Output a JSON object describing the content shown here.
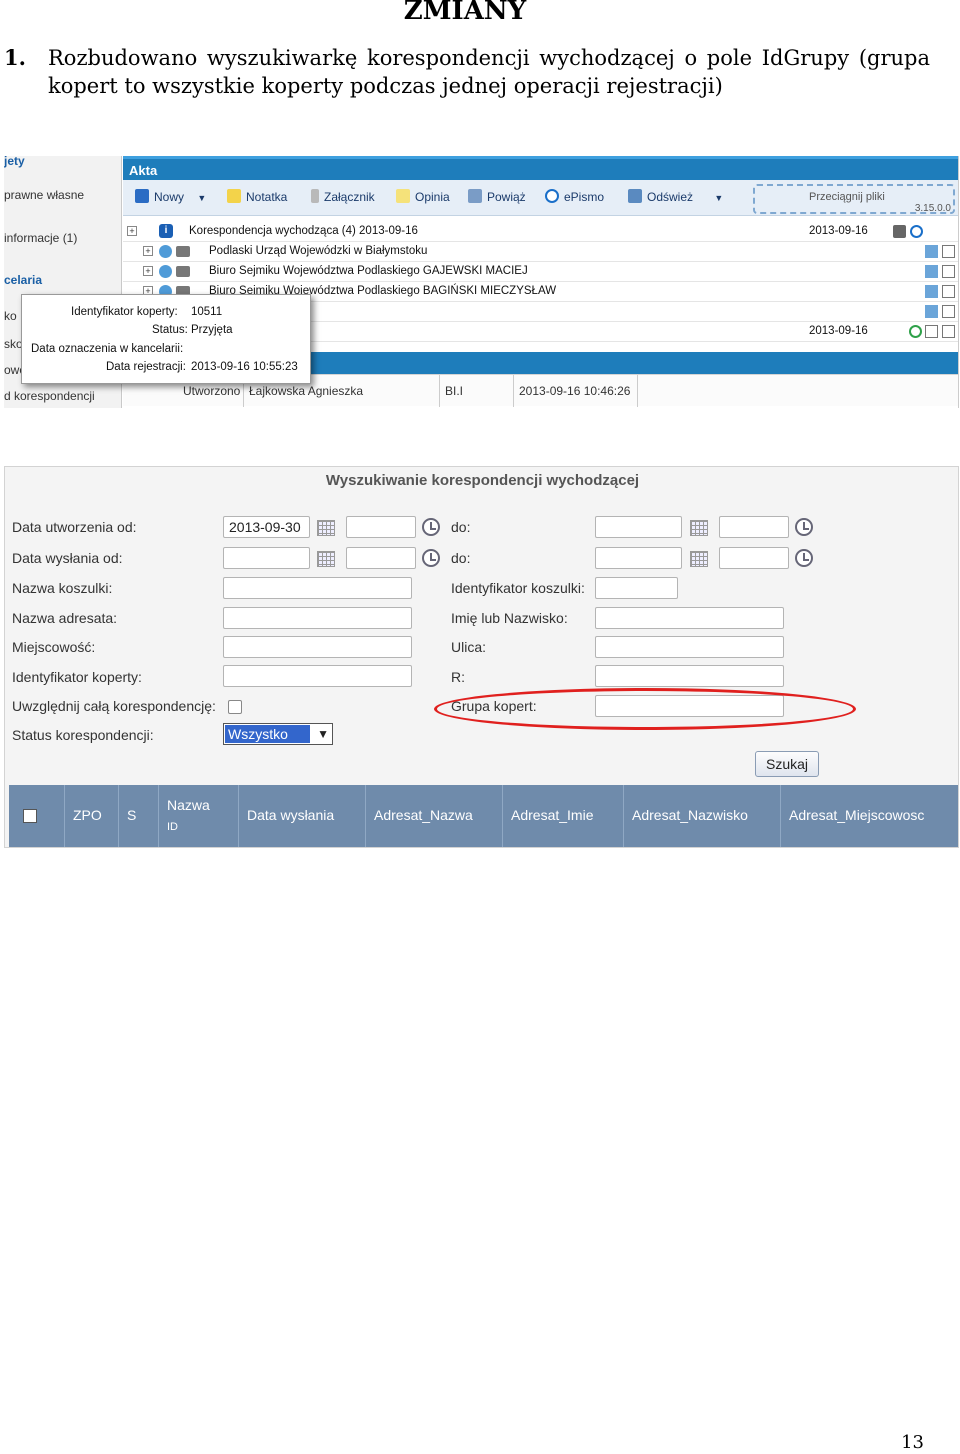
{
  "document": {
    "title": "ZMIANY",
    "item_number": "1.",
    "item_text": "Rozbudowano wyszukiwarkę korespondencji wychodzącej o pole IdGrupy (grupa kopert to wszystkie koperty podczas jednej operacji rejestracji)",
    "page_number": "13"
  },
  "shot1": {
    "sidebar": [
      "jety",
      "prawne własne",
      "informacje (1)",
      "celaria",
      "ko",
      "sko",
      "owo",
      "d korespondencji"
    ],
    "panel_title": "Akta",
    "toolbar": {
      "new": "Nowy",
      "note": "Notatka",
      "attachment": "Załącznik",
      "opinion": "Opinia",
      "link": "Powiąż",
      "epismo": "ePismo",
      "refresh": "Odśwież",
      "drop": "Przeciągnij pliki",
      "version": "3.15.0.0"
    },
    "rows": [
      {
        "text": "Korespondencja wychodząca (4) 2013-09-16",
        "date": "2013-09-16"
      },
      {
        "text": "Podlaski Urząd Wojewódzki w Białymstoku",
        "date": ""
      },
      {
        "text": "Biuro Sejmiku Województwa Podlaskiego GAJEWSKI MACIEJ",
        "date": ""
      },
      {
        "text": "Biuro Sejmiku Województwa Podlaskiego BAGIŃSKI MIECZYSŁAW",
        "date": ""
      },
      {
        "text": "",
        "date": "2013-09-16"
      }
    ],
    "tooltip": {
      "id_label": "Identyfikator koperty:",
      "id_value": "10511",
      "status_label": "Status:",
      "status_value": "Przyjęta",
      "marked_label": "Data oznaczenia w kancelarii:",
      "reg_label": "Data rejestracji:",
      "reg_value": "2013-09-16 10:55:23"
    },
    "footer": {
      "created_label": "Utworzono",
      "created_by": "Łajkowska Agnieszka",
      "dept": "BI.I",
      "created_at": "2013-09-16 10:46:26"
    }
  },
  "shot2": {
    "title": "Wyszukiwanie korespondencji wychodzącej",
    "fields": {
      "created_from": "Data utworzenia od:",
      "created_from_value": "2013-09-30",
      "sent_from": "Data wysłania od:",
      "to": "do:",
      "folder_name": "Nazwa koszulki:",
      "folder_id": "Identyfikator koszulki:",
      "addressee": "Nazwa adresata:",
      "name": "Imię lub Nazwisko:",
      "city": "Miejscowość:",
      "street": "Ulica:",
      "envelope_id": "Identyfikator koperty:",
      "r": "R:",
      "include_all": "Uwzględnij całą korespondencję:",
      "group": "Grupa kopert:",
      "status": "Status korespondencji:",
      "status_value": "Wszystko"
    },
    "search_button": "Szukaj",
    "grid_columns": {
      "zpo": "ZPO",
      "s": "S",
      "name": "Nazwa",
      "id": "ID",
      "sent_date": "Data wysłania",
      "adr_name": "Adresat_Nazwa",
      "adr_first": "Adresat_Imie",
      "adr_last": "Adresat_Nazwisko",
      "adr_city": "Adresat_Miejscowosc"
    },
    "highlight_color": "#e0201e"
  }
}
